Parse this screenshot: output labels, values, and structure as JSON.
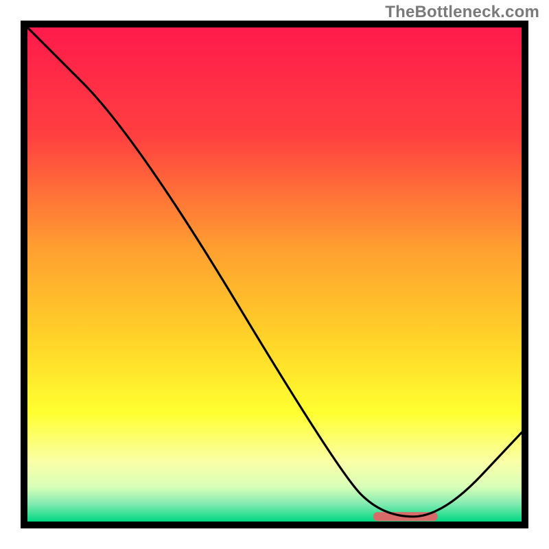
{
  "watermark": "TheBottleneck.com",
  "chart_data": {
    "type": "line",
    "title": "",
    "xlabel": "",
    "ylabel": "",
    "xlim": [
      0,
      100
    ],
    "ylim": [
      0,
      100
    ],
    "x": [
      0,
      22,
      63,
      72,
      84,
      100
    ],
    "values": [
      100,
      78,
      10,
      1,
      1,
      18
    ],
    "marker": {
      "x_start": 70,
      "x_end": 83,
      "y": 1
    },
    "gradient_stops": [
      {
        "offset": 0.0,
        "color": "#ff1a4b"
      },
      {
        "offset": 0.22,
        "color": "#ff4040"
      },
      {
        "offset": 0.45,
        "color": "#ffa030"
      },
      {
        "offset": 0.62,
        "color": "#ffd028"
      },
      {
        "offset": 0.78,
        "color": "#ffff30"
      },
      {
        "offset": 0.88,
        "color": "#faffa8"
      },
      {
        "offset": 0.93,
        "color": "#d8ffb8"
      },
      {
        "offset": 0.965,
        "color": "#80eab0"
      },
      {
        "offset": 1.0,
        "color": "#00d780"
      }
    ],
    "marker_color": "#d86a6a"
  }
}
